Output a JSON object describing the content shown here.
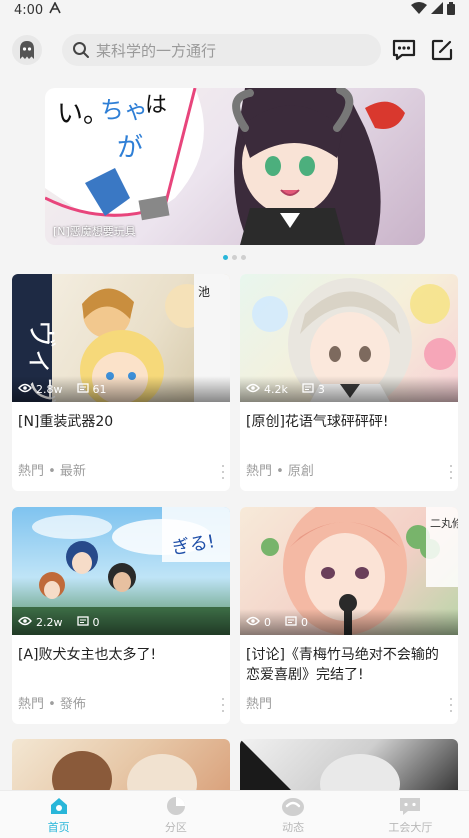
{
  "status_bar": {
    "time": "4:00"
  },
  "search": {
    "placeholder": "某科学的一方通行"
  },
  "banner": {
    "caption": "[N]恶魔想要玩具",
    "art_text": [
      "ちゃ",
      "が",
      "は",
      "い。"
    ]
  },
  "cards": [
    {
      "title": "[N]重装武器20",
      "views": "2.8w",
      "comments": "61",
      "meta": "熱門 • 最新",
      "cover_text": "ヴィブジ"
    },
    {
      "title": "[原创]花语气球砰砰砰!",
      "views": "4.2k",
      "comments": "3",
      "meta": "熱門 • 原創",
      "cover_text": ""
    },
    {
      "title": "[A]败犬女主也太多了!",
      "views": "2.2w",
      "comments": "0",
      "meta": "熱門 • 發佈",
      "cover_text": "ぎる!"
    },
    {
      "title": "[讨论]《青梅竹马绝对不会输的恋爱喜剧》完结了!",
      "views": "0",
      "comments": "0",
      "meta": "熱門",
      "cover_text": "二丸修一"
    }
  ],
  "nav": [
    {
      "label": "首页",
      "icon": "home-icon",
      "active": true
    },
    {
      "label": "分区",
      "icon": "category-icon",
      "active": false
    },
    {
      "label": "动态",
      "icon": "feed-icon",
      "active": false
    },
    {
      "label": "工会大厅",
      "icon": "guild-icon",
      "active": false
    }
  ],
  "colors": {
    "accent": "#29b6d9",
    "meta": "#9e9e9e"
  }
}
